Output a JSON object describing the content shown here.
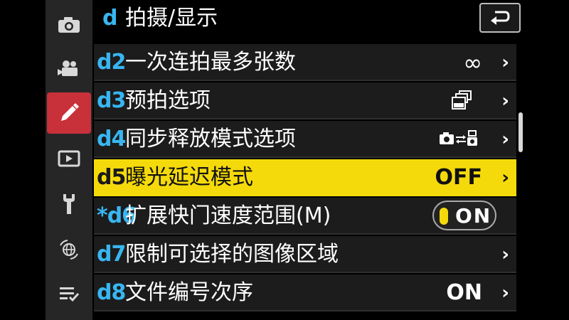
{
  "header": {
    "letter": "d",
    "title": "拍摄/显示"
  },
  "colors": {
    "accent": "#38b6f2",
    "selected": "#f5da0b",
    "active_tab": "#c8303a"
  },
  "sidebar": {
    "items": [
      {
        "icon": "camera-icon"
      },
      {
        "icon": "movie-camera-icon"
      },
      {
        "icon": "pencil-icon",
        "active": true
      },
      {
        "icon": "playback-icon"
      },
      {
        "icon": "wrench-icon"
      },
      {
        "icon": "network-icon"
      },
      {
        "icon": "my-menu-icon"
      }
    ]
  },
  "menu": {
    "items": [
      {
        "code": "d2",
        "label": "一次连拍最多张数",
        "value": "∞",
        "value_icon": ""
      },
      {
        "code": "d3",
        "label": "预拍选项",
        "value": "",
        "value_icon": "pre-capture-icon"
      },
      {
        "code": "d4",
        "label": "同步释放模式选项",
        "value": "",
        "value_icon": "sync-release-icon"
      },
      {
        "code": "d5",
        "label": "曝光延迟模式",
        "value": "OFF",
        "value_icon": "",
        "selected": true
      },
      {
        "code": "*d6",
        "label": "扩展快门速度范围(M)",
        "value": "ON",
        "value_icon": "toggle"
      },
      {
        "code": "d7",
        "label": "限制可选择的图像区域",
        "value": "",
        "value_icon": ""
      },
      {
        "code": "d8",
        "label": "文件编号次序",
        "value": "ON",
        "value_icon": ""
      }
    ]
  }
}
